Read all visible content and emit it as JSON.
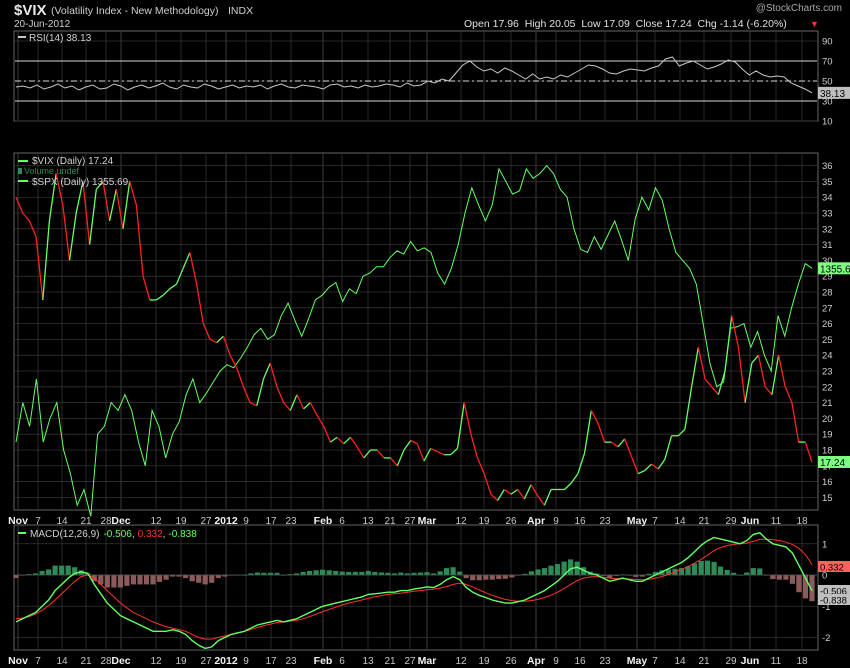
{
  "header": {
    "symbol": "$VIX",
    "name": "(Volatility Index - New Methodology)",
    "exchange": "INDX",
    "date": "20-Jun-2012",
    "watermark": "@StockCharts.com",
    "ohlc_text": "Open 17.96  High 20.05  Low 17.09  Close 17.24  Chg -1.14 (-6.20%)",
    "down_arrow": "▼"
  },
  "colors": {
    "vix": "#ff2020",
    "vix_up": "#66ff66",
    "spx": "#66ff66",
    "rsi": "#c8c8c8",
    "macd": "#66ff66",
    "signal": "#ff3030",
    "hist_pos": "#2e8b57",
    "hist_neg": "#8b5a5a",
    "grid": "#333333",
    "panel_border": "#666666"
  },
  "x_labels": [
    "Nov",
    "7",
    "14",
    "21",
    "28",
    "Dec",
    "12",
    "19",
    "27",
    "2012",
    "9",
    "17",
    "23",
    "Feb",
    "6",
    "13",
    "21",
    "27",
    "Mar",
    "12",
    "19",
    "26",
    "Apr",
    "9",
    "16",
    "23",
    "May",
    "7",
    "14",
    "21",
    "29",
    "Jun",
    "11",
    "18"
  ],
  "x_bold": [
    "Nov",
    "Dec",
    "2012",
    "Feb",
    "Mar",
    "Apr",
    "May",
    "Jun"
  ],
  "chart_data": [
    {
      "type": "line",
      "panel": "RSI",
      "legend": "RSI(14) 38.13",
      "last_value_label": "38.13",
      "y_ticks": [
        10,
        30,
        50,
        70,
        90
      ],
      "ylim": [
        10,
        100
      ],
      "reference_lines": [
        30,
        50,
        70
      ],
      "values": [
        44,
        45,
        43,
        46,
        42,
        44,
        47,
        43,
        45,
        41,
        44,
        46,
        42,
        43,
        47,
        45,
        41,
        44,
        46,
        43,
        45,
        48,
        44,
        42,
        46,
        44,
        43,
        47,
        45,
        42,
        44,
        46,
        43,
        45,
        44,
        46,
        42,
        45,
        47,
        44,
        43,
        46,
        45,
        44,
        42,
        46,
        47,
        44,
        45,
        43,
        46,
        44,
        45,
        47,
        46,
        44,
        48,
        45,
        46,
        50,
        48,
        52,
        50,
        58,
        66,
        70,
        64,
        60,
        62,
        58,
        63,
        60,
        56,
        52,
        57,
        52,
        54,
        52,
        56,
        54,
        58,
        62,
        66,
        65,
        62,
        58,
        57,
        60,
        62,
        61,
        60,
        63,
        65,
        72,
        74,
        65,
        68,
        70,
        66,
        62,
        64,
        67,
        71,
        69,
        62,
        56,
        60,
        56,
        54,
        55,
        54,
        48,
        45,
        42,
        38.13
      ]
    },
    {
      "type": "line",
      "panel": "price",
      "series": [
        {
          "name": "$VIX (Daily)",
          "legend": "$VIX (Daily) 17.24",
          "last_value_label": "17.24",
          "y_ticks": [
            15,
            16,
            17,
            18,
            19,
            20,
            21,
            22,
            23,
            24,
            25,
            26,
            27,
            28,
            29,
            30,
            31,
            32,
            33,
            34,
            35,
            36
          ],
          "ylim": [
            14.2,
            36.8
          ],
          "values": [
            34,
            33,
            32.5,
            31.5,
            27.5,
            32.5,
            35.5,
            33.5,
            30,
            33,
            35,
            31,
            34.5,
            35,
            32.5,
            34.5,
            32,
            35,
            33.5,
            29,
            27.5,
            27.5,
            27.8,
            28.2,
            28.5,
            29.5,
            30.5,
            28.5,
            26,
            25,
            24.8,
            25.2,
            24,
            23.2,
            22,
            21,
            20.8,
            22.5,
            23.5,
            22,
            21,
            20.5,
            21.5,
            20.6,
            21,
            20.2,
            19.5,
            18.5,
            18.8,
            18.4,
            18.8,
            18.2,
            17.5,
            18,
            18,
            17.5,
            17.5,
            17,
            18,
            18.6,
            18.4,
            17.3,
            18.1,
            17.9,
            17.7,
            17.7,
            18.1,
            21,
            19,
            17.5,
            16.5,
            15.2,
            14.8,
            15.5,
            15.2,
            15.5,
            14.9,
            15.8,
            15.1,
            14.5,
            15.5,
            15.5,
            15.5,
            15.9,
            16.5,
            17.8,
            20.5,
            19.7,
            18.5,
            18.5,
            18.2,
            18.7,
            17.6,
            16.5,
            16.7,
            17.1,
            16.8,
            17.4,
            18.9,
            18.9,
            19.3,
            22,
            24.5,
            22.5,
            22,
            21.5,
            23,
            26.5,
            24.5,
            21,
            23.5,
            24,
            22,
            21.5,
            24,
            22,
            21,
            18.5,
            18.5,
            17.24
          ]
        },
        {
          "name": "$SPX (Daily)",
          "legend": "$SPX (Daily) 1355.69",
          "last_value_label": "1355.69",
          "values": [
            18.5,
            21,
            19.5,
            22.5,
            18.5,
            20,
            21,
            18,
            16.5,
            14.5,
            15.5,
            13.8,
            19,
            19.5,
            21,
            20.5,
            21.5,
            20.5,
            18.5,
            17,
            20.5,
            19.5,
            17.5,
            19,
            19.8,
            21.5,
            22.5,
            21,
            21.6,
            22.3,
            23,
            23.4,
            23.2,
            23.8,
            24.5,
            25.3,
            25.7,
            25,
            25.3,
            26.5,
            27.3,
            26.2,
            25.2,
            26.3,
            27.5,
            27.8,
            28.3,
            28.6,
            27.4,
            28.2,
            27.9,
            29,
            29.2,
            29.6,
            29.6,
            30.2,
            30.6,
            30.4,
            31.2,
            30.6,
            30.8,
            30.5,
            29.2,
            28.5,
            29.5,
            31,
            33,
            34.6,
            33.5,
            32.5,
            33.5,
            35.8,
            35,
            34.2,
            34.4,
            35.8,
            35.2,
            35.5,
            36,
            35.5,
            34.5,
            34,
            32,
            30.7,
            30.5,
            31.5,
            30.7,
            31.6,
            32.5,
            31.3,
            30,
            32.6,
            34,
            33.2,
            34.6,
            33.8,
            32,
            30.5,
            30,
            29.5,
            28.5,
            26,
            23.5,
            22,
            22.3,
            25.7,
            25.8,
            26,
            24.5,
            25.5,
            24,
            23,
            26.5,
            25.2,
            27,
            28.5,
            29.8,
            29.5
          ]
        }
      ],
      "volume_legend": "Volume undef"
    },
    {
      "type": "line",
      "panel": "MACD",
      "legend_label": "MACD(12,26,9)",
      "legend_values": [
        "-0.506",
        "0.332",
        "-0.838"
      ],
      "y_ticks": [
        -2,
        -1,
        0,
        1
      ],
      "ylim": [
        -2.4,
        1.6
      ],
      "last_value_labels": [
        "0.332",
        "-0.506",
        "-0.838"
      ],
      "series": [
        {
          "name": "MACD",
          "values": [
            -1.5,
            -1.4,
            -1.3,
            -1.2,
            -1.0,
            -0.8,
            -0.5,
            -0.3,
            -0.1,
            0.05,
            0.1,
            0.05,
            -0.3,
            -0.6,
            -0.9,
            -1.1,
            -1.3,
            -1.4,
            -1.5,
            -1.6,
            -1.7,
            -1.8,
            -1.8,
            -1.8,
            -1.75,
            -1.8,
            -1.9,
            -2.1,
            -2.25,
            -2.35,
            -2.3,
            -2.1,
            -2.0,
            -1.9,
            -1.85,
            -1.8,
            -1.7,
            -1.6,
            -1.55,
            -1.5,
            -1.45,
            -1.5,
            -1.45,
            -1.4,
            -1.3,
            -1.2,
            -1.1,
            -1.0,
            -0.95,
            -0.9,
            -0.85,
            -0.8,
            -0.75,
            -0.7,
            -0.62,
            -0.6,
            -0.58,
            -0.55,
            -0.55,
            -0.5,
            -0.5,
            -0.45,
            -0.42,
            -0.38,
            -0.4,
            -0.3,
            -0.15,
            -0.05,
            -0.15,
            -0.4,
            -0.55,
            -0.65,
            -0.72,
            -0.8,
            -0.85,
            -0.9,
            -0.9,
            -0.85,
            -0.8,
            -0.7,
            -0.6,
            -0.5,
            -0.35,
            -0.2,
            0.0,
            0.2,
            0.25,
            0.15,
            0.05,
            0.0,
            -0.1,
            -0.2,
            -0.15,
            -0.1,
            -0.15,
            -0.2,
            -0.2,
            -0.1,
            0.0,
            0.1,
            0.2,
            0.3,
            0.4,
            0.55,
            0.75,
            0.95,
            1.1,
            1.2,
            1.15,
            1.1,
            1.05,
            1.0,
            1.1,
            1.3,
            1.35,
            1.15,
            1.0,
            0.95,
            0.9,
            0.7,
            0.3,
            -0.1,
            -0.506
          ]
        },
        {
          "name": "Signal",
          "values": [
            -1.4,
            -1.38,
            -1.33,
            -1.25,
            -1.13,
            -0.98,
            -0.8,
            -0.6,
            -0.4,
            -0.2,
            -0.05,
            0.0,
            -0.1,
            -0.3,
            -0.5,
            -0.7,
            -0.9,
            -1.05,
            -1.2,
            -1.3,
            -1.4,
            -1.5,
            -1.58,
            -1.65,
            -1.7,
            -1.75,
            -1.8,
            -1.9,
            -2.0,
            -2.05,
            -2.05,
            -2.0,
            -1.95,
            -1.9,
            -1.85,
            -1.8,
            -1.75,
            -1.68,
            -1.62,
            -1.57,
            -1.52,
            -1.5,
            -1.48,
            -1.45,
            -1.4,
            -1.33,
            -1.25,
            -1.17,
            -1.1,
            -1.03,
            -0.96,
            -0.9,
            -0.85,
            -0.8,
            -0.75,
            -0.7,
            -0.66,
            -0.62,
            -0.6,
            -0.58,
            -0.55,
            -0.52,
            -0.5,
            -0.47,
            -0.45,
            -0.42,
            -0.37,
            -0.3,
            -0.26,
            -0.3,
            -0.38,
            -0.48,
            -0.57,
            -0.65,
            -0.72,
            -0.78,
            -0.82,
            -0.84,
            -0.84,
            -0.82,
            -0.78,
            -0.72,
            -0.65,
            -0.55,
            -0.43,
            -0.3,
            -0.18,
            -0.1,
            -0.06,
            -0.05,
            -0.07,
            -0.1,
            -0.12,
            -0.12,
            -0.13,
            -0.14,
            -0.15,
            -0.14,
            -0.1,
            -0.05,
            0.02,
            0.1,
            0.18,
            0.27,
            0.38,
            0.5,
            0.64,
            0.78,
            0.88,
            0.94,
            0.98,
            1.0,
            1.02,
            1.08,
            1.14,
            1.15,
            1.13,
            1.1,
            1.05,
            0.98,
            0.85,
            0.65,
            0.332
          ]
        }
      ]
    }
  ]
}
